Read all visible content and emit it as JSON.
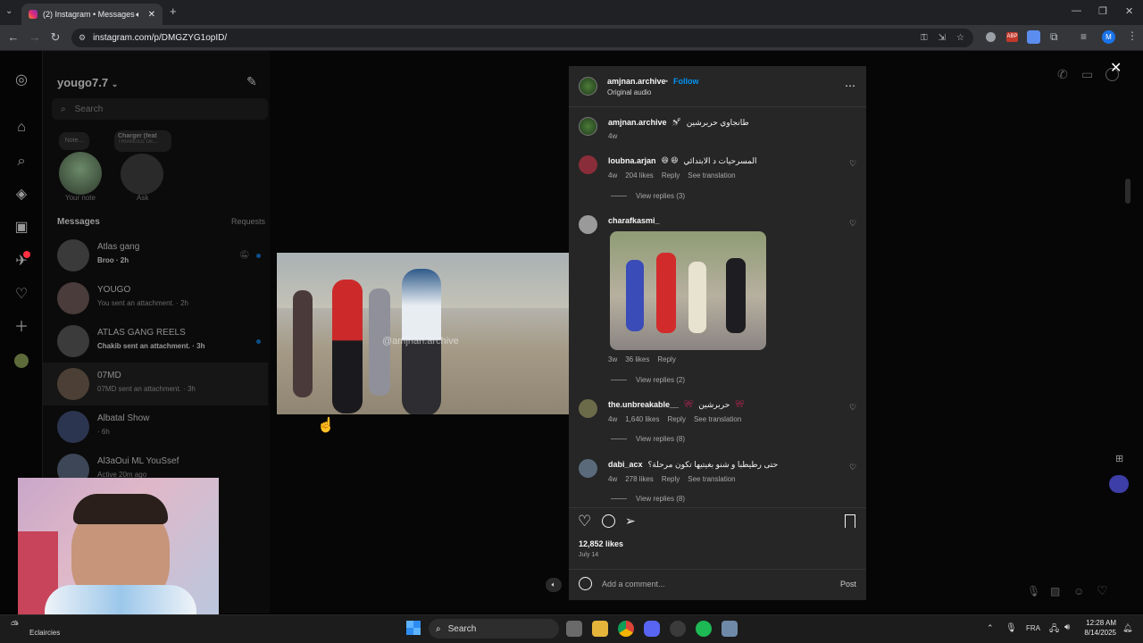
{
  "browser": {
    "tab_title": "(2) Instagram • Messages",
    "url": "instagram.com/p/DMGZYG1opID/",
    "profile_initial": "M"
  },
  "sidebar": {
    "username": "yougo7.7",
    "search_placeholder": "Search",
    "notes": [
      {
        "bubble": "Note...",
        "caption": "Your note"
      },
      {
        "bubble": "Charger (feat",
        "bubble_sub": "TRIANGLE DE...",
        "caption": "Ask"
      }
    ],
    "messages_label": "Messages",
    "requests_label": "Requests",
    "threads": [
      {
        "name": "Atlas gang",
        "sub": "Broo · 2h"
      },
      {
        "name": "YOUGO",
        "sub": "You sent an attachment. · 2h"
      },
      {
        "name": "ATLAS GANG REELS",
        "sub": "Chakib sent an attachment. · 3h"
      },
      {
        "name": "07MD",
        "sub": "07MD sent an attachment. · 3h"
      },
      {
        "name": "Albatal Show",
        "sub": "· 6h"
      },
      {
        "name": "Al3aOui ML YouSsef",
        "sub": "Active 20m ago"
      }
    ]
  },
  "video": {
    "watermark": "@amjnan.archive"
  },
  "post": {
    "author": "amjnan.archive",
    "follow_label": "Follow",
    "audio": "Original audio",
    "caption_user": "amjnan.archive",
    "caption_text": "طانجاوي حربرشين",
    "caption_time": "4w",
    "comments": [
      {
        "user": "loubna.arjan",
        "text": "المسرحيات د الابتدائي",
        "time": "4w",
        "likes": "204 likes",
        "reply": "Reply",
        "translate": "See translation",
        "view_replies": "View replies (3)"
      },
      {
        "user": "charafkasmi_",
        "text": "",
        "time": "3w",
        "likes": "36 likes",
        "reply": "Reply",
        "translate": "",
        "view_replies": "View replies (2)"
      },
      {
        "user": "the.unbreakable__",
        "text": "حربرشين",
        "time": "4w",
        "likes": "1,640 likes",
        "reply": "Reply",
        "translate": "See translation",
        "view_replies": "View replies (8)"
      },
      {
        "user": "dabi_acx",
        "text": "حتى رطيطبا و شنو بغيتيها تكون مرحلة؟",
        "time": "4w",
        "likes": "278 likes",
        "reply": "Reply",
        "translate": "See translation",
        "view_replies": "View replies (8)"
      }
    ],
    "likes": "12,852 likes",
    "date": "July 14",
    "comment_placeholder": "Add a comment...",
    "post_label": "Post"
  },
  "taskbar": {
    "weather": "Eclaircies",
    "search_label": "Search",
    "language": "FRA",
    "time": "12:28 AM",
    "date": "8/14/2025"
  },
  "colors": {
    "accent": "#0095f6",
    "panel": "#262626",
    "page": "#060606"
  }
}
